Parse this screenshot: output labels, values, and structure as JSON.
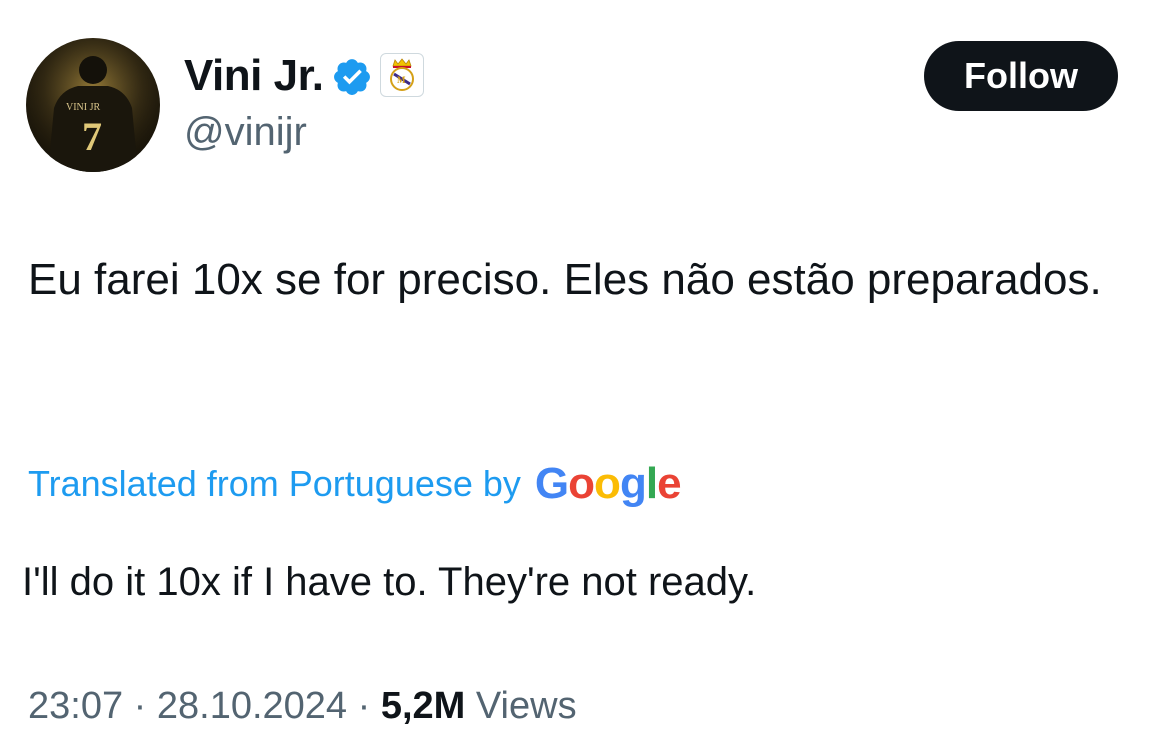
{
  "author": {
    "display_name": "Vini Jr.",
    "handle": "@vinijr",
    "avatar_text": "VINI JR",
    "avatar_number": "7",
    "verified_icon": "verified-badge-icon",
    "affiliate_icon": "real-madrid-crest-icon"
  },
  "follow_button": {
    "label": "Follow"
  },
  "tweet": {
    "text": "Eu farei 10x se for preciso. Eles não estão preparados."
  },
  "translation": {
    "label": "Translated from Portuguese by",
    "provider": {
      "letters": [
        "G",
        "o",
        "o",
        "g",
        "l",
        "e"
      ],
      "colors": [
        "#4285F4",
        "#EA4335",
        "#FBBC05",
        "#4285F4",
        "#34A853",
        "#EA4335"
      ]
    },
    "text": "I'll do it 10x if I have to. They're not ready."
  },
  "meta": {
    "time": "23:07",
    "date": "28.10.2024",
    "separator": "·",
    "views_count": "5,2M",
    "views_label": "Views"
  },
  "colors": {
    "text_primary": "#0f1419",
    "text_secondary": "#536471",
    "link": "#1d9bf0",
    "verified": "#1d9bf0"
  }
}
